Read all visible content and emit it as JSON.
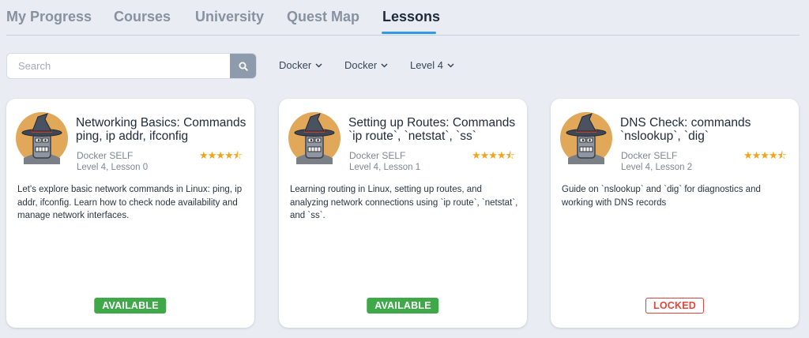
{
  "tabs": [
    {
      "label": "My Progress"
    },
    {
      "label": "Courses"
    },
    {
      "label": "University"
    },
    {
      "label": "Quest Map"
    },
    {
      "label": "Lessons",
      "active": true
    }
  ],
  "search": {
    "placeholder": "Search",
    "value": ""
  },
  "filters": [
    {
      "label": "Docker"
    },
    {
      "label": "Docker"
    },
    {
      "label": "Level 4"
    }
  ],
  "colors": {
    "accent": "#2f9be4",
    "available": "#3fa849",
    "locked": "#e0463c",
    "star": "#f2a51a"
  },
  "cards": [
    {
      "title": "Networking Basics: Commands ping, ip addr, ifconfig",
      "author": "Docker SELF",
      "level": "Level 4, Lesson 0",
      "rating_stars": 4.5,
      "description": "Let's explore basic network commands in Linux: ping, ip addr, ifconfig. Learn how to check node availability and manage network interfaces.",
      "status": "AVAILABLE"
    },
    {
      "title": "Setting up Routes: Commands `ip route`, `netstat`, `ss`",
      "author": "Docker SELF",
      "level": "Level 4, Lesson 1",
      "rating_stars": 4.5,
      "description": "Learning routing in Linux, setting up routes, and analyzing network connections using `ip route`, `netstat`, and `ss`.",
      "status": "AVAILABLE"
    },
    {
      "title": "DNS Check: commands `nslookup`, `dig`",
      "author": "Docker SELF",
      "level": "Level 4, Lesson 2",
      "rating_stars": 4.5,
      "description": "Guide on `nslookup` and `dig` for diagnostics and working with DNS records",
      "status": "LOCKED"
    }
  ]
}
